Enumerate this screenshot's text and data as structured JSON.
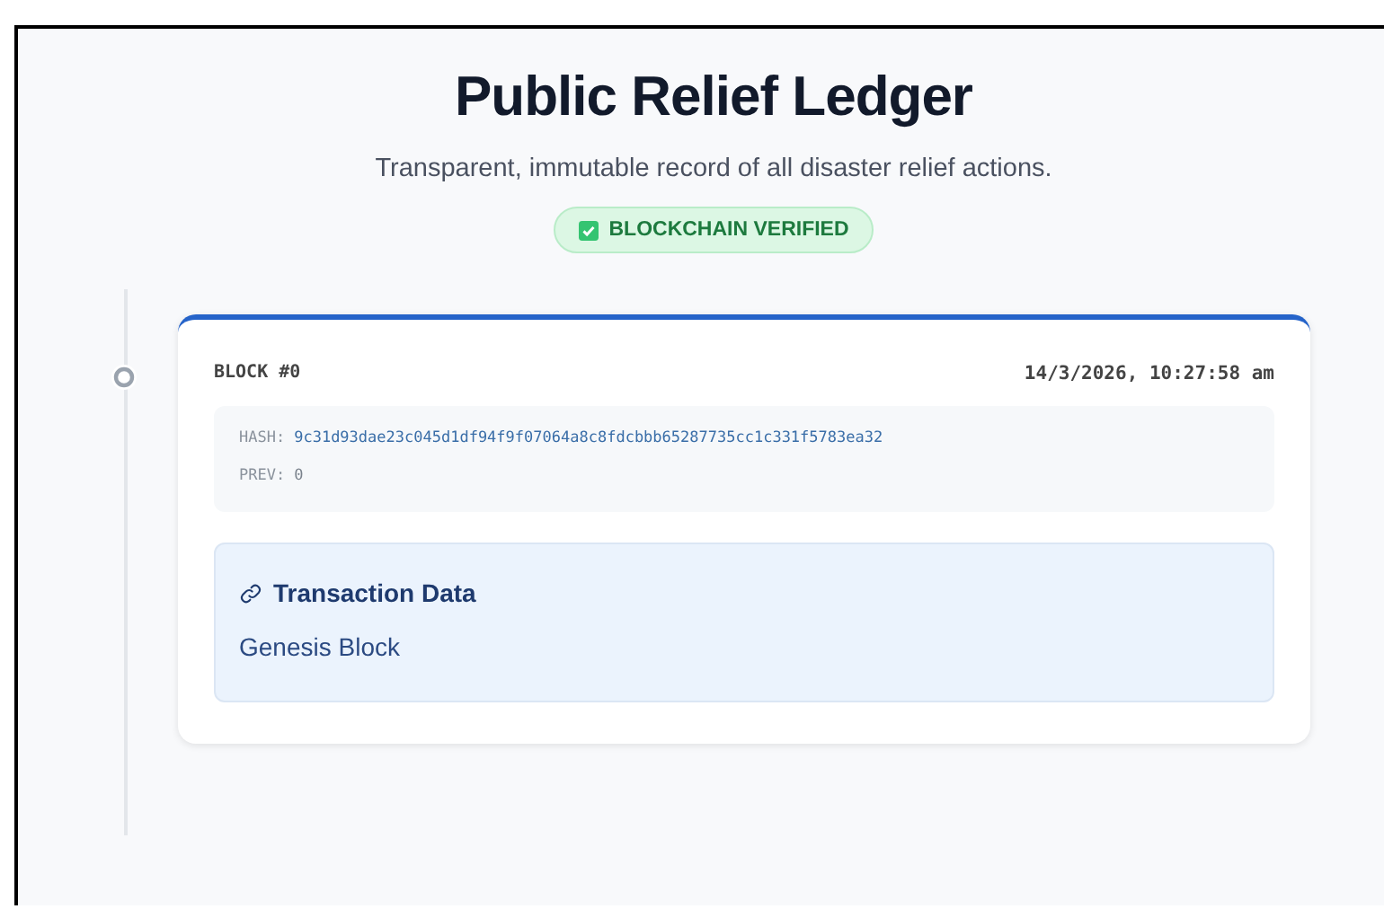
{
  "header": {
    "title": "Public Relief Ledger",
    "subtitle": "Transparent, immutable record of all disaster relief actions.",
    "badge": {
      "label": "BLOCKCHAIN VERIFIED",
      "verified": true
    }
  },
  "blocks": [
    {
      "label": "BLOCK #0",
      "timestamp": "14/3/2026, 10:27:58 am",
      "hash_label": "HASH:",
      "hash": "9c31d93dae23c045d1df94f9f07064a8c8fdcbbb65287735cc1c331f5783ea32",
      "prev_label": "PREV:",
      "prev": "0",
      "data_title": "Transaction Data",
      "data": "Genesis Block"
    }
  ]
}
